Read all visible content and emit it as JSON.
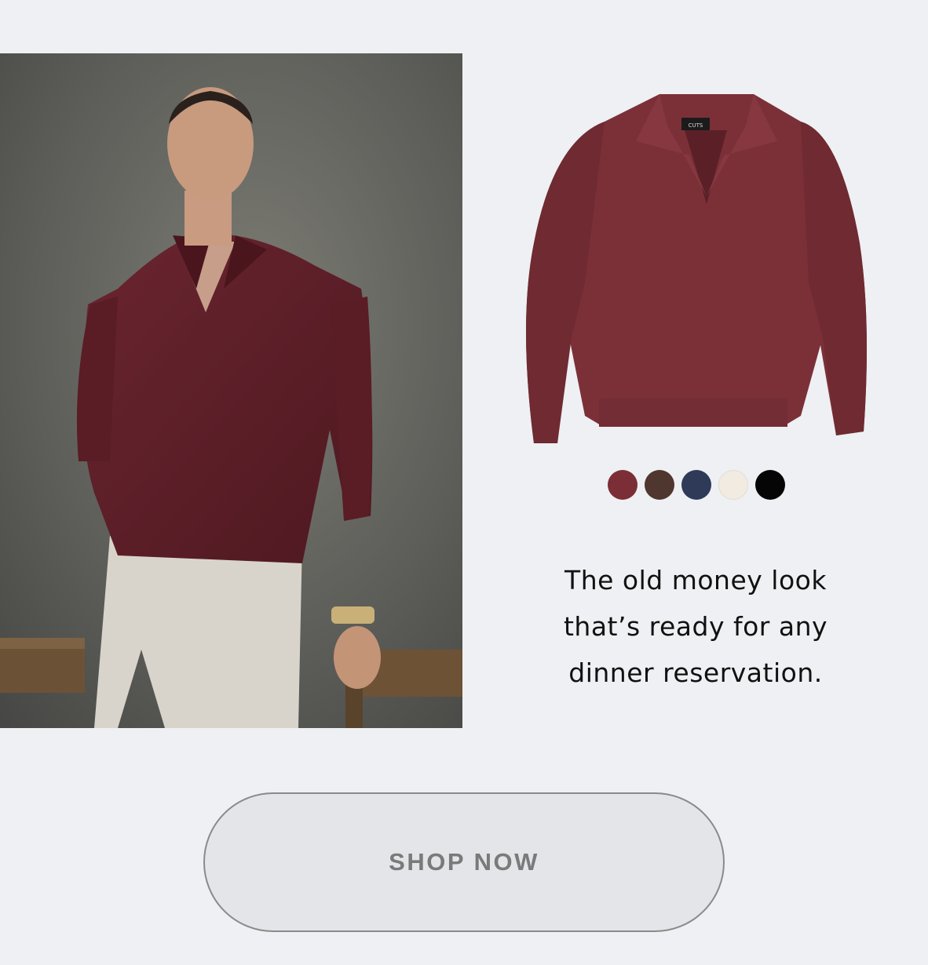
{
  "product": {
    "brand_tag": "CUTS",
    "tagline_lines": [
      "The old money look",
      "that’s ready for any",
      "dinner reservation."
    ]
  },
  "swatches": [
    {
      "name": "burgundy",
      "color": "#7b2e35"
    },
    {
      "name": "brown",
      "color": "#4f362e"
    },
    {
      "name": "navy",
      "color": "#2e3a58"
    },
    {
      "name": "cream",
      "color": "#f1ebe1"
    },
    {
      "name": "black",
      "color": "#050505"
    }
  ],
  "cta": {
    "label": "SHOP NOW"
  },
  "colors": {
    "background": "#eef0f3",
    "sweater": "#7b3038",
    "text": "#111111",
    "button_text": "#7a7a7a"
  }
}
